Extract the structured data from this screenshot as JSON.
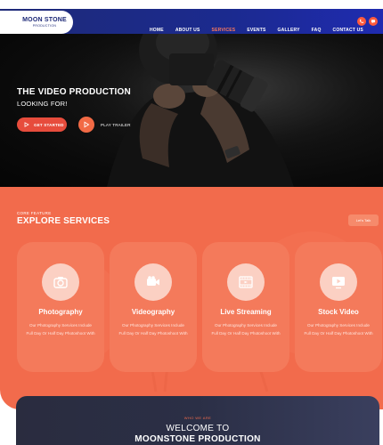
{
  "brand": {
    "name": "MOON STONE",
    "tagline": "PRODUCTION"
  },
  "nav": {
    "items": [
      {
        "label": "HOME",
        "active": false
      },
      {
        "label": "ABOUT US",
        "active": false
      },
      {
        "label": "SERVICES",
        "active": true
      },
      {
        "label": "EVENTS",
        "active": false
      },
      {
        "label": "GALLERY",
        "active": false
      },
      {
        "label": "FAQ",
        "active": false
      },
      {
        "label": "CONTACT US",
        "active": false
      }
    ],
    "icons": [
      "phone-icon",
      "chat-icon"
    ]
  },
  "hero": {
    "title": "THE VIDEO PRODUCTION",
    "subtitle": "LOOKING FOR!",
    "cta_label": "GET STARTED",
    "trailer_label": "PLAY TRAILER"
  },
  "services": {
    "eyebrow": "CORE FEATURE",
    "title": "EXPLORE SERVICES",
    "talk_label": "Let's Talk",
    "cards": [
      {
        "title": "Photography",
        "icon": "camera-icon",
        "desc": "Our Photography Services Include Full Day Or Half Day Photoshoot With"
      },
      {
        "title": "Videography",
        "icon": "video-camera-icon",
        "desc": "Our Photography Services Include Full Day Or Half Day Photoshoot With"
      },
      {
        "title": "Live Streaming",
        "icon": "film-strip-icon",
        "desc": "Our Photography Services Include Full Day Or Half Day Photoshoot With"
      },
      {
        "title": "Stock Video",
        "icon": "play-screen-icon",
        "desc": "Our Photography Services Include Full Day Or Half Day Photoshoot With"
      }
    ]
  },
  "welcome": {
    "eyebrow": "WHO WE ARE",
    "line1": "WELCOME TO",
    "line2": "MOONSTONE PRODUCTION"
  },
  "colors": {
    "nav": "#1e2a78",
    "accent": "#f26b4c",
    "active_link": "#ff7a5c",
    "welcome_bg": "#2b2f46"
  }
}
